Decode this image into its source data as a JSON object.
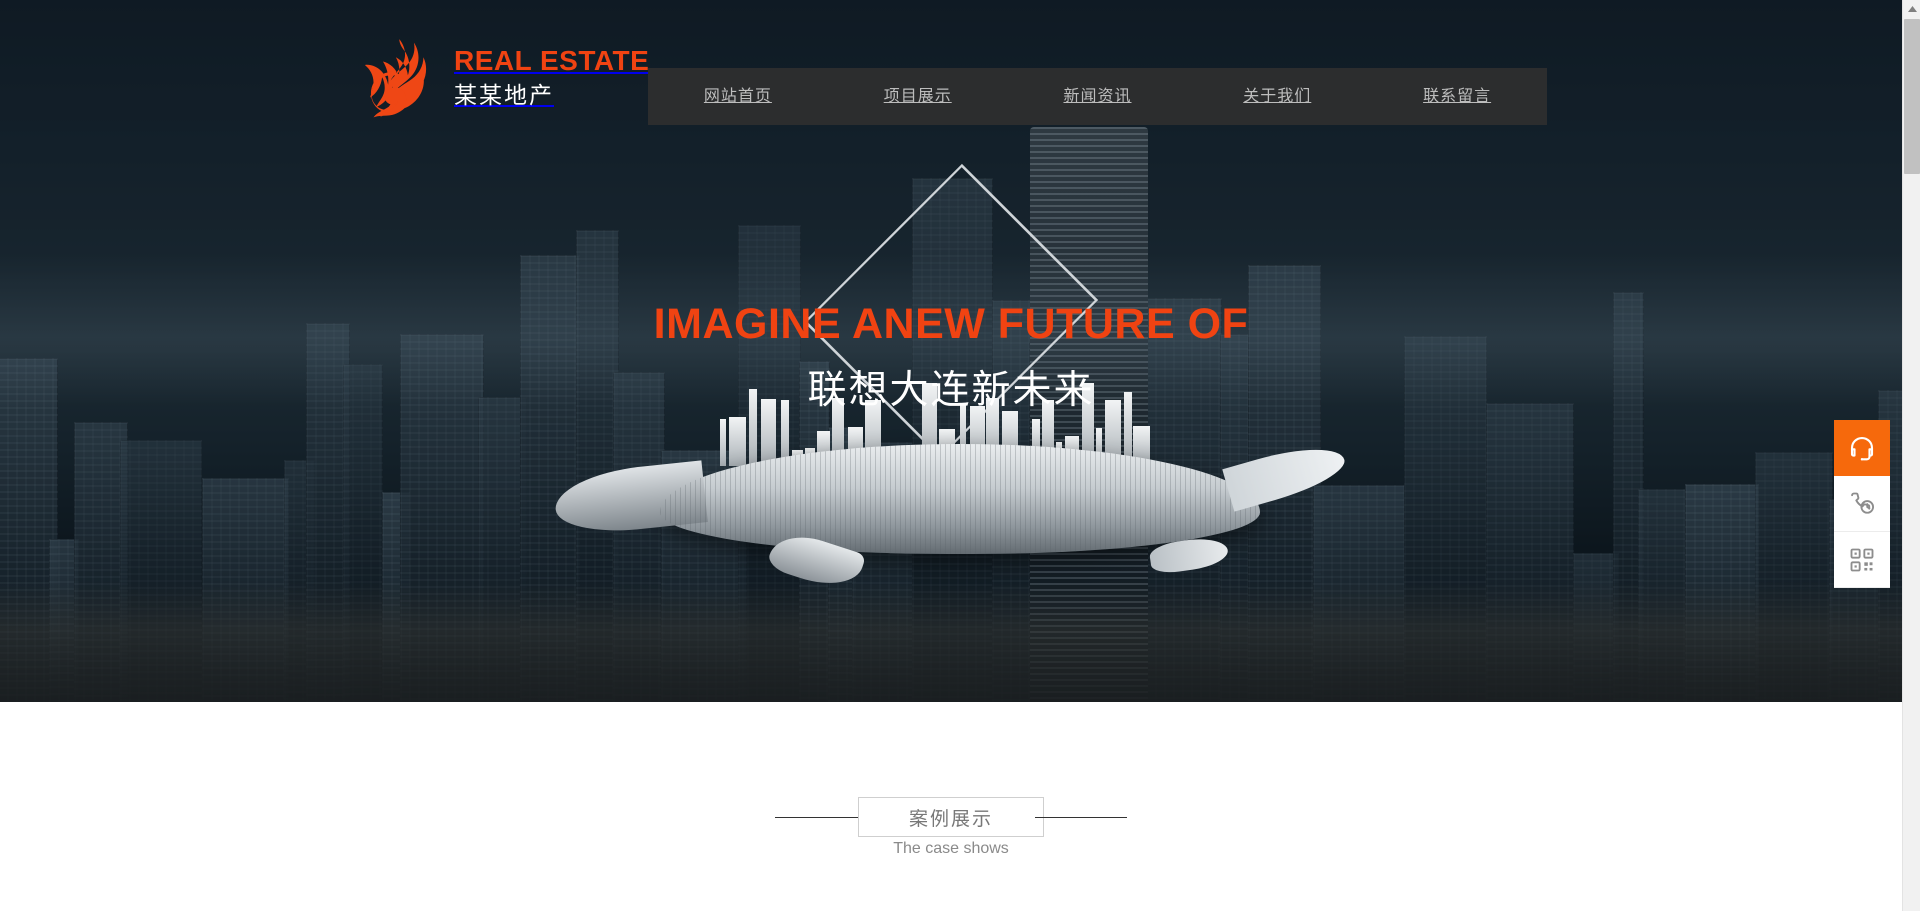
{
  "brand": {
    "logo_icon": "phoenix-flame-icon",
    "english_name": "REAL ESTATE",
    "chinese_name": "某某地产",
    "accent_color": "#f04312"
  },
  "nav": {
    "background_color": "#2f2f2f",
    "text_color": "#bdbdbd",
    "items": [
      {
        "label": "网站首页"
      },
      {
        "label": "项目展示"
      },
      {
        "label": "新闻资讯"
      },
      {
        "label": "关于我们"
      },
      {
        "label": "联系留言"
      }
    ]
  },
  "hero": {
    "headline_en": "IMAGINE ANEW FUTURE OF",
    "headline_cn": "联想大连新未来",
    "headline_en_color": "#f04312",
    "headline_cn_color": "#ffffff",
    "decoration": "diamond-outline",
    "background_description": "city skyline with whale carrying a city"
  },
  "case_section": {
    "title_cn": "案例展示",
    "title_en": "The case shows",
    "title_color": "#777777",
    "subtitle_color": "#8a8a8a",
    "background_color": "#ffffff"
  },
  "side_toolbar": {
    "buttons": [
      {
        "icon": "headset-icon",
        "accent": true,
        "color": "#f6690c"
      },
      {
        "icon": "phone-clock-icon",
        "accent": false,
        "color": "#ffffff"
      },
      {
        "icon": "qr-code-icon",
        "accent": false,
        "color": "#ffffff"
      }
    ]
  },
  "scrollbar": {
    "arrow_icon": "triangle-up-icon",
    "track_color": "#f1f1f1",
    "thumb_color": "#c1c1c1"
  }
}
